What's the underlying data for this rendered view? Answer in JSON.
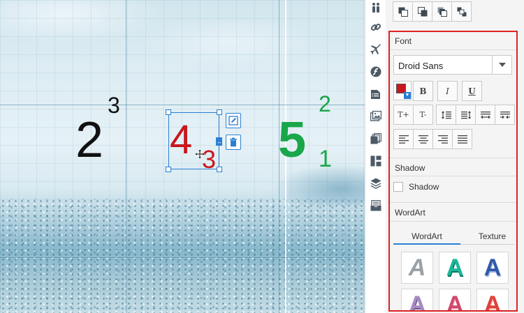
{
  "canvas": {
    "glyphs": {
      "two_big": "2",
      "two_sup": "3",
      "four_big": "4",
      "four_sub": "3",
      "five_big": "5",
      "five_sup": "2",
      "five_sub": "1"
    },
    "colors": {
      "black": "#111111",
      "red": "#c8171e",
      "green": "#1aa64a",
      "selection": "#2a7fd4"
    }
  },
  "selection_tools": [
    "edit-icon",
    "trash-icon"
  ],
  "icon_strip": [
    "people-icon",
    "link-icon",
    "plane-icon",
    "flash-icon",
    "document-icon",
    "image-icon",
    "pages-icon",
    "layout-icon",
    "layers-icon",
    "inbox-icon"
  ],
  "arrange_buttons": [
    "bring-forward-icon",
    "send-backward-icon",
    "bring-to-front-icon",
    "send-to-back-icon"
  ],
  "font_section": {
    "title": "Font",
    "font_family": "Droid Sans",
    "color": "#c8171e",
    "bold": "B",
    "italic": "I",
    "underline": "U",
    "superscript": "T+",
    "subscript": "T-"
  },
  "shadow_section": {
    "title": "Shadow",
    "checkbox_label": "Shadow",
    "checked": false
  },
  "wordart_section": {
    "title": "WordArt",
    "tabs": [
      "WordArt",
      "Texture"
    ],
    "active_tab": "WordArt",
    "tiles": [
      {
        "letter": "A",
        "color": "#9aa0a6"
      },
      {
        "letter": "A",
        "color": "#1ab89a"
      },
      {
        "letter": "A",
        "color": "#2e5aa8"
      },
      {
        "letter": "A",
        "color": "#a98bc4"
      },
      {
        "letter": "A",
        "color": "#d0486c"
      },
      {
        "letter": "A",
        "color": "#e0403a"
      }
    ]
  }
}
